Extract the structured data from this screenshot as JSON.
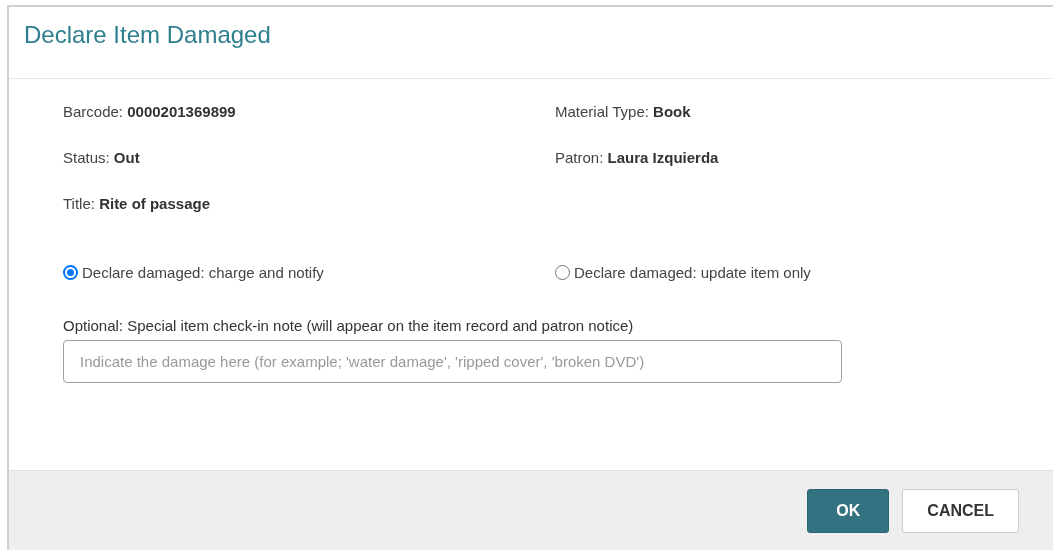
{
  "dialog": {
    "title": "Declare Item Damaged"
  },
  "details": {
    "left": [
      "Barcode: **0000201369899**",
      "Status: **Out**",
      "Title: **Rite of passage**"
    ],
    "right": [
      "Material Type: **Book**",
      "Patron: **Laura Izquierda**"
    ]
  },
  "options": [
    {
      "label": "Declare damaged: charge and notify",
      "selected": true
    },
    {
      "label": "Declare damaged: update item only",
      "selected": false
    }
  ],
  "note": {
    "label": "Optional: Special item check-in note (will appear on the item record and patron notice)",
    "placeholder": "Indicate the damage here (for example; 'water damage', 'ripped cover', 'broken DVD')"
  },
  "buttons": [
    {
      "label": "OK",
      "kind": "primary"
    },
    {
      "label": "CANCEL",
      "kind": "secondary"
    }
  ]
}
